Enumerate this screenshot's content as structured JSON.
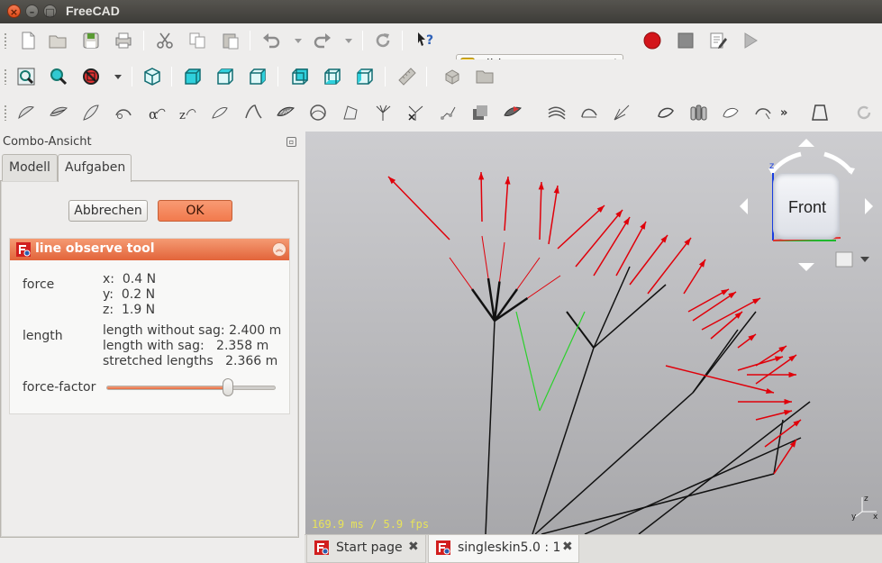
{
  "window": {
    "title": "FreeCAD",
    "close": "×",
    "min": "–",
    "max": "□"
  },
  "toolbar": {
    "workbench": "glider",
    "workbench_icon": "glider-workbench-icon",
    "row1_icons": [
      "new-file-icon",
      "open-file-icon",
      "save-icon",
      "print-icon",
      "cut-icon",
      "copy-icon",
      "paste-icon",
      "undo-icon",
      "redo-icon",
      "refresh-icon",
      "whats-this-icon",
      "macro-record-icon",
      "macro-stop-icon",
      "macro-edit-icon",
      "macro-run-icon"
    ],
    "row2_icons": [
      "fit-all-icon",
      "fit-selection-icon",
      "draw-style-icon",
      "view-isometric-icon",
      "view-front-icon",
      "view-top-icon",
      "view-right-icon",
      "view-rear-icon",
      "view-bottom-icon",
      "view-left-icon",
      "measure-icon",
      "part-icon",
      "group-icon"
    ],
    "row3_icons": [
      "glider-tool-1-icon",
      "glider-tool-2-icon",
      "glider-tool-3-icon",
      "glider-tool-4-icon",
      "glider-tool-5-icon",
      "glider-tool-6-icon",
      "glider-tool-7-icon",
      "glider-tool-8-icon",
      "glider-tool-9-icon",
      "glider-tool-10-icon",
      "glider-tool-11-icon",
      "glider-tool-12-icon",
      "glider-tool-13-icon",
      "glider-tool-14-icon",
      "glider-tool-15-icon",
      "glider-tool-16-icon",
      "glider-tool-17-icon",
      "glider-tool-18-icon",
      "glider-tool-19-icon",
      "glider-tool-20-icon",
      "glider-tool-21-icon",
      "glider-tool-22-icon",
      "glider-tool-23-icon"
    ],
    "overflow": "»"
  },
  "combo": {
    "title": "Combo-Ansicht",
    "tabs": [
      {
        "label": "Modell"
      },
      {
        "label": "Aufgaben"
      }
    ],
    "cancel_label": "Abbrechen",
    "ok_label": "OK"
  },
  "tool": {
    "title": "line observe tool",
    "force_label": "force",
    "force_x": "x:  0.4 N",
    "force_y": "y:  0.2 N",
    "force_z": "z:  1.9 N",
    "length_label": "length",
    "length_without_sag": "length without sag: 2.400 m",
    "length_with_sag": "length with sag:   2.358 m",
    "stretched_lengths": "stretched lengths   2.366 m",
    "factor_label": "force-factor",
    "factor_value": 0.72
  },
  "view": {
    "fps": "169.9 ms / 5.9 fps",
    "navcube_face": "Front",
    "axis_z": "z",
    "axis_x": "x",
    "axis_y": "y",
    "colors": {
      "lines": "#111111",
      "forces": "#e0000a",
      "selected": "#2bd12b"
    }
  },
  "doc_tabs": [
    {
      "label": "Start page",
      "close": "✖"
    },
    {
      "label": "singleskin5.0 : 1",
      "close": "✖"
    }
  ]
}
